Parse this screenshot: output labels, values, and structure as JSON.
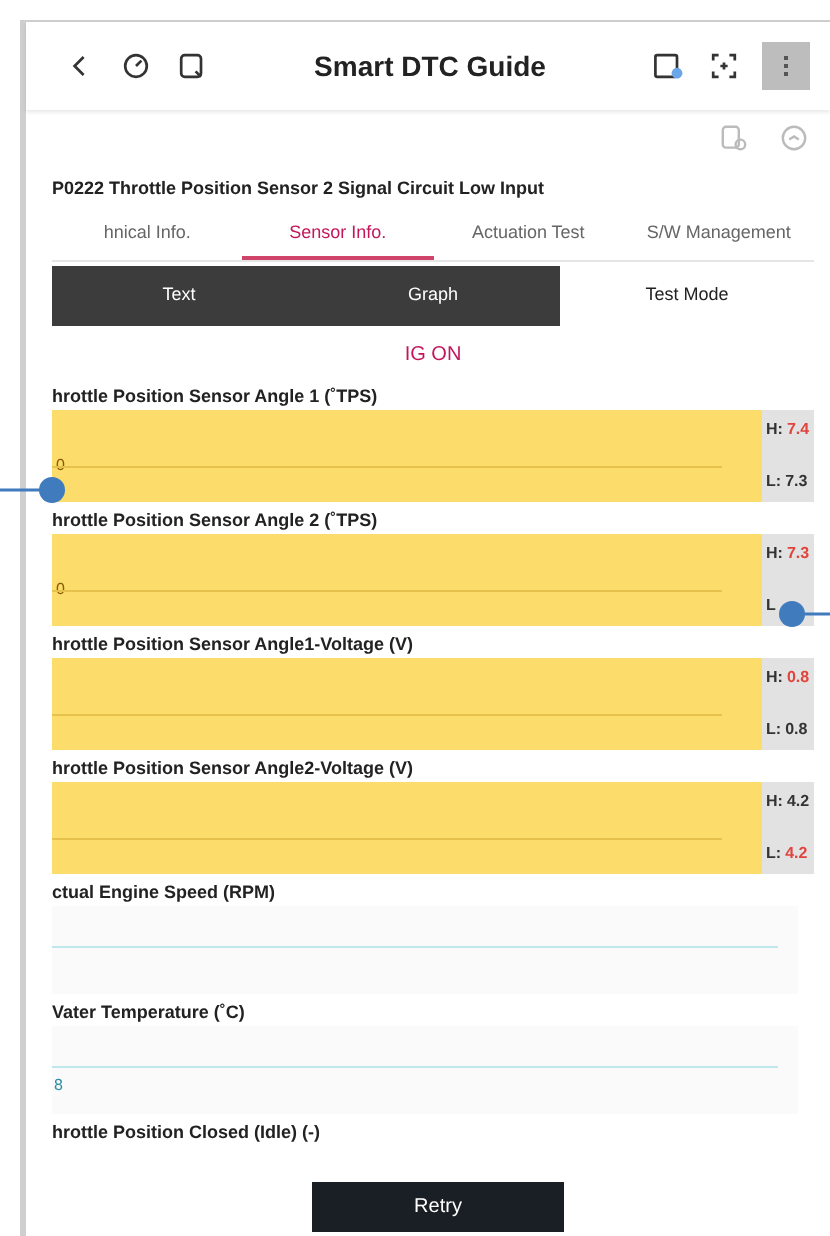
{
  "header": {
    "title": "Smart DTC Guide"
  },
  "dtc_title": "P0222 Throttle Position Sensor 2 Signal Circuit Low Input",
  "tabs": [
    {
      "label": "hnical Info.",
      "selected": false
    },
    {
      "label": "Sensor Info.",
      "selected": true
    },
    {
      "label": "Actuation Test",
      "selected": false
    },
    {
      "label": "S/W Management",
      "selected": false
    }
  ],
  "modes": [
    {
      "label": "Text",
      "highlighted": true
    },
    {
      "label": "Graph",
      "highlighted": true
    },
    {
      "label": "Test Mode",
      "highlighted": false
    }
  ],
  "status": "IG ON",
  "graphs": [
    {
      "kind": "alarm",
      "title": "hrottle Position Sensor Angle 1 (˚TPS)",
      "axis": "0",
      "limits": [
        {
          "label": "H:",
          "value": "7.4",
          "alert": true
        },
        {
          "label": "L:",
          "value": "7.3",
          "alert": false
        }
      ]
    },
    {
      "kind": "alarm",
      "title": "hrottle Position Sensor Angle 2 (˚TPS)",
      "axis": "0",
      "limits": [
        {
          "label": "H:",
          "value": "7.3",
          "alert": true
        },
        {
          "label": "L"
        }
      ]
    },
    {
      "kind": "alarm",
      "title": "hrottle Position Sensor Angle1-Voltage (V)",
      "limits": [
        {
          "label": "H:",
          "value": "0.8",
          "alert": true
        },
        {
          "label": "L:",
          "value": "0.8",
          "alert": false
        }
      ]
    },
    {
      "kind": "alarm",
      "title": "hrottle Position Sensor Angle2-Voltage (V)",
      "limits": [
        {
          "label": "H:",
          "value": "4.2",
          "alert": false
        },
        {
          "label": "L:",
          "value": "4.2",
          "alert": true
        }
      ]
    },
    {
      "kind": "normal",
      "title": "ctual Engine Speed (RPM)"
    },
    {
      "kind": "normal",
      "title": "Vater Temperature (˚C)",
      "axis": "8"
    },
    {
      "kind": "cut",
      "title": "hrottle Position Closed (Idle) (-)"
    }
  ],
  "retry_button": "Retry"
}
